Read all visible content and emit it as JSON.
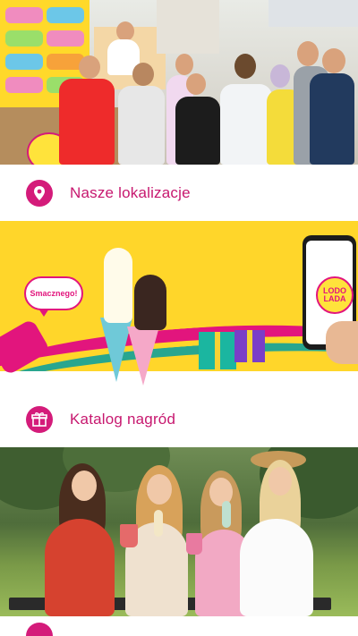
{
  "menu": {
    "locations": {
      "label": "Nasze lokalizacje",
      "icon": "location-pin-icon"
    },
    "rewards": {
      "label": "Katalog nagród",
      "icon": "gift-icon"
    },
    "next": {
      "icon": "circle-icon"
    }
  },
  "banners": {
    "stand": {
      "alt": "ice-cream-stand-photo"
    },
    "promo": {
      "bubble_text": "Smacznego!",
      "app_logo_text": "LODO LADA"
    },
    "friends": {
      "alt": "girls-with-ice-cream-photo"
    }
  },
  "colors": {
    "accent": "#d41b7a",
    "label": "#c7186f",
    "promo_bg": "#ffd62a"
  }
}
